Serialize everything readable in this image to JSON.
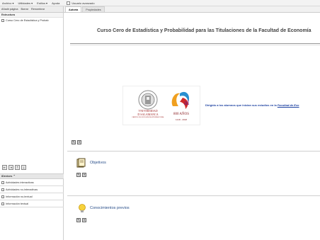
{
  "menu": {
    "items": [
      "Archivo ▾",
      "Utilidades ▾",
      "Estilos ▾",
      "Ayuda"
    ],
    "advanced_user_label": "Usuario avanzado"
  },
  "tree_toolbar": {
    "add_page": "Añadir página",
    "delete": "Borrar",
    "rename": "Renombrar"
  },
  "tabs": [
    {
      "label": "Autoría",
      "active": true
    },
    {
      "label": "Propiedades",
      "active": false
    }
  ],
  "structure": {
    "heading": "Estructura",
    "items": [
      "Curso Cero de Estadística y Probab"
    ]
  },
  "nav_buttons": [
    "⇤",
    "⇥",
    "⇡",
    "⇣"
  ],
  "idevices": {
    "heading": "iDevices ⌃",
    "items": [
      "Actividades interactivas",
      "Actividades no-interactivas",
      "Información no-textual",
      "Información textual"
    ]
  },
  "main": {
    "course_title": "Curso Cero de Estadística y Probabilidad para las Titulaciones de la Facultad de Economía",
    "university": {
      "line1": "VNIVERSIDAD",
      "line2": "D SALAMANCA",
      "sub": "CAMPUS DE EXCELENCIA INTERNACIONAL"
    },
    "anniversary": {
      "text": "800 AÑOS",
      "years": "1218 - 2018"
    },
    "intro_text": "Dirigido a los alumnos que inician sus estudios en la ",
    "intro_link": "Facultad de Eco",
    "sections": [
      {
        "title": "Objetivos"
      },
      {
        "title": "Conocimientos previos"
      }
    ]
  },
  "colors": {
    "title": "#444444",
    "section_title": "#2a4f8a",
    "link": "#1a3fa0",
    "university_red": "#9c1a1a"
  }
}
